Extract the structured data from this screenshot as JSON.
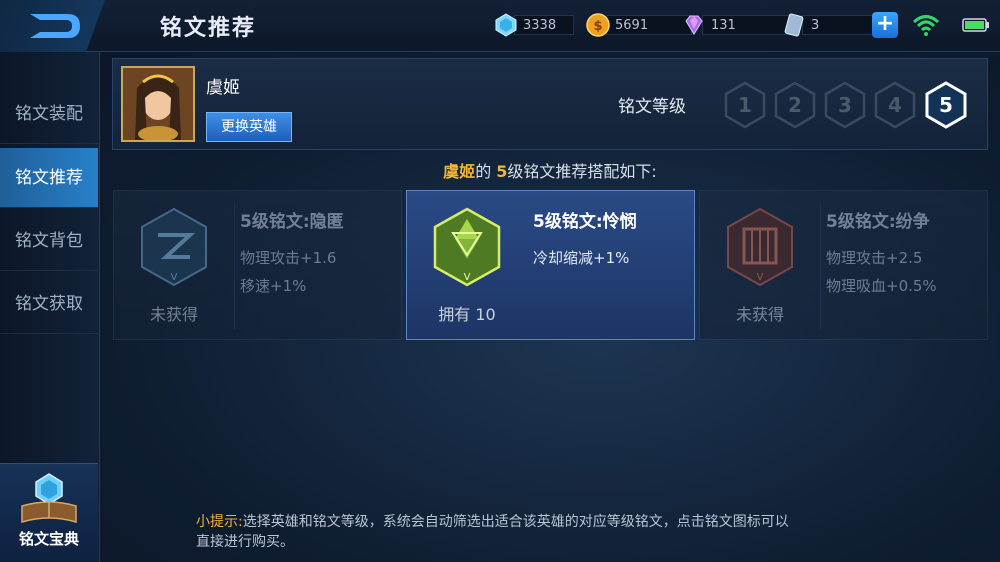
{
  "header": {
    "title": "铭文推荐",
    "resources": [
      {
        "icon": "diamond-icon",
        "value": "3338"
      },
      {
        "icon": "gold-coin-icon",
        "value": "5691"
      },
      {
        "icon": "purple-gem-icon",
        "value": "131"
      },
      {
        "icon": "voucher-card-icon",
        "value": "3"
      }
    ]
  },
  "sidebar": {
    "items": [
      {
        "label": "铭文装配"
      },
      {
        "label": "铭文推荐"
      },
      {
        "label": "铭文背包"
      },
      {
        "label": "铭文获取"
      }
    ],
    "codex_label": "铭文宝典"
  },
  "hero": {
    "name": "虞姬",
    "swap_label": "更换英雄",
    "level_label": "铭文等级",
    "levels": [
      "1",
      "2",
      "3",
      "4",
      "5"
    ],
    "selected_level": "5"
  },
  "headline": {
    "hero": "虞姬",
    "mid": "的 ",
    "level": "5",
    "tail": "级铭文推荐搭配如下:"
  },
  "cards": [
    {
      "name": "5级铭文:隐匿",
      "stats": [
        "物理攻击+1.6",
        "移速+1%"
      ],
      "stock": "未获得",
      "color": "#3a6ea0"
    },
    {
      "name": "5级铭文:怜悯",
      "stats": [
        "冷却缩减+1%"
      ],
      "stock": "拥有 10",
      "color": "#7fb53a"
    },
    {
      "name": "5级铭文:纷争",
      "stats": [
        "物理攻击+2.5",
        "物理吸血+0.5%"
      ],
      "stock": "未获得",
      "color": "#b04434"
    }
  ],
  "tip": {
    "label": "小提示:",
    "text": "选择英雄和铭文等级，系统会自动筛选出适合该英雄的对应等级铭文，点击铭文图标可以直接进行购买。"
  }
}
